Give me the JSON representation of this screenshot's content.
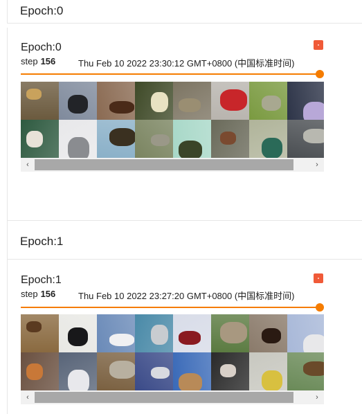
{
  "sections": [
    {
      "header": "Epoch:0",
      "card": {
        "title": "Epoch:0",
        "step_label": "step",
        "step_value": "156",
        "timestamp": "Thu Feb 10 2022 23:30:12 GMT+0800 (中国标准时间)",
        "slider_value": 1.0,
        "tiles": [
          {
            "bg": "#6b5a3e",
            "fg": "#c9a25c"
          },
          {
            "bg": "#7f8a9c",
            "fg": "#222428"
          },
          {
            "bg": "#8a6a52",
            "fg": "#4a2a18"
          },
          {
            "bg": "#3f4a28",
            "fg": "#e8e2c2"
          },
          {
            "bg": "#7c7462",
            "fg": "#9a8e72"
          },
          {
            "bg": "#b8b4ae",
            "fg": "#c8262a"
          },
          {
            "bg": "#7a9a40",
            "fg": "#a8a890"
          },
          {
            "bg": "#2d3448",
            "fg": "#b8a8d8"
          },
          {
            "bg": "#2e5a40",
            "fg": "#e8e2d8"
          },
          {
            "bg": "#e8e8ea",
            "fg": "#8a8c90"
          },
          {
            "bg": "#8ab0c8",
            "fg": "#3a3020"
          },
          {
            "bg": "#7a8460",
            "fg": "#9a9888"
          },
          {
            "bg": "#a8d8c8",
            "fg": "#3a4428"
          },
          {
            "bg": "#6a6a5a",
            "fg": "#7a4a30"
          },
          {
            "bg": "#b0b49a",
            "fg": "#2a6a58"
          },
          {
            "bg": "#4a4e52",
            "fg": "#b8b8b0"
          }
        ]
      }
    },
    {
      "header": "Epoch:1",
      "card": {
        "title": "Epoch:1",
        "step_label": "step",
        "step_value": "156",
        "timestamp": "Thu Feb 10 2022 23:27:20 GMT+0800 (中国标准时间)",
        "slider_value": 1.0,
        "tiles": [
          {
            "bg": "#8a6a40",
            "fg": "#5a3a20"
          },
          {
            "bg": "#e8e8e4",
            "fg": "#18181a"
          },
          {
            "bg": "#6a8ab8",
            "fg": "#f0f0f2"
          },
          {
            "bg": "#4a8aa8",
            "fg": "#c8ccd0"
          },
          {
            "bg": "#d8dce8",
            "fg": "#8a1a20"
          },
          {
            "bg": "#5a7a40",
            "fg": "#a89880"
          },
          {
            "bg": "#8a7a6a",
            "fg": "#2a1a12"
          },
          {
            "bg": "#a8b8d8",
            "fg": "#e8e8ea"
          },
          {
            "bg": "#6a5040",
            "fg": "#c87838"
          },
          {
            "bg": "#586478",
            "fg": "#e8e8ec"
          },
          {
            "bg": "#7a6040",
            "fg": "#b8b0a0"
          },
          {
            "bg": "#3a4a88",
            "fg": "#d8dae0"
          },
          {
            "bg": "#3a6ab8",
            "fg": "#b88a58"
          },
          {
            "bg": "#2a2a2a",
            "fg": "#d8d0c8"
          },
          {
            "bg": "#c8c8c0",
            "fg": "#d8c040"
          },
          {
            "bg": "#6a8a58",
            "fg": "#6a4a2a"
          }
        ]
      }
    }
  ],
  "icons": {
    "scroll_left": "‹",
    "scroll_right": "›"
  },
  "colors": {
    "accent": "#f57c00",
    "badge": "#f05a38"
  }
}
